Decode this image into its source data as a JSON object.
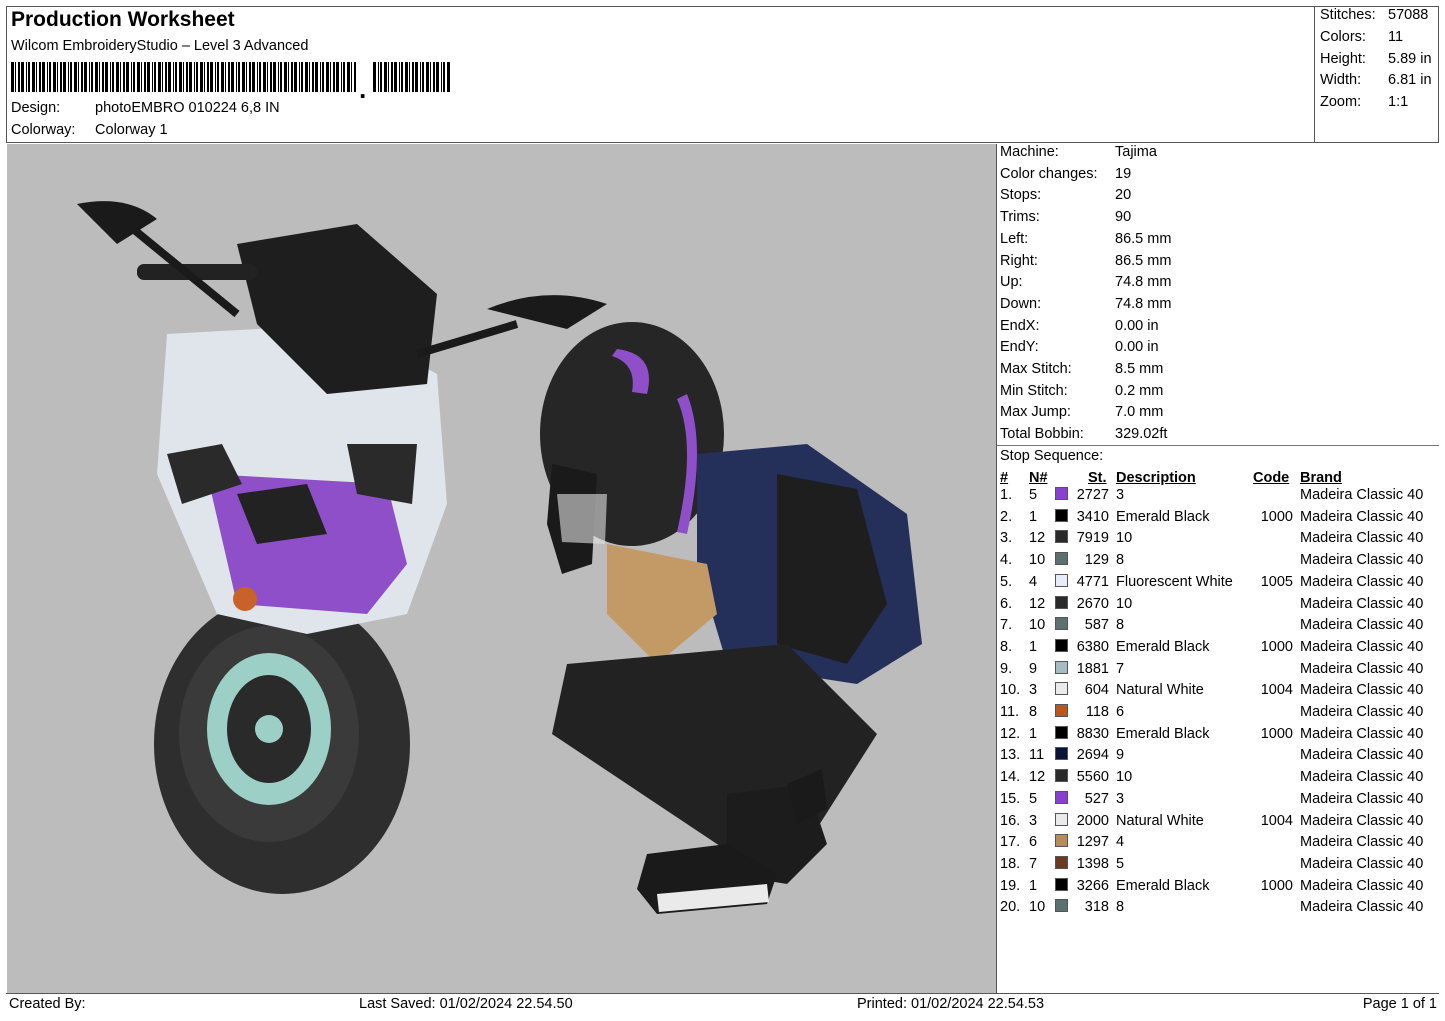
{
  "header": {
    "title": "Production Worksheet",
    "subtitle": "Wilcom EmbroideryStudio – Level 3 Advanced",
    "design_label": "Design:",
    "design_value": "photoEMBRO 010224 6,8 IN",
    "colorway_label": "Colorway:",
    "colorway_value": "Colorway 1"
  },
  "summary": [
    {
      "label": "Stitches:",
      "value": "57088"
    },
    {
      "label": "Colors:",
      "value": "11"
    },
    {
      "label": "Height:",
      "value": "5.89 in"
    },
    {
      "label": "Width:",
      "value": "6.81 in"
    },
    {
      "label": "Zoom:",
      "value": "1:1"
    }
  ],
  "info": [
    {
      "label": "Machine:",
      "value": "Tajima"
    },
    {
      "label": "Color changes:",
      "value": "19"
    },
    {
      "label": "Stops:",
      "value": "20"
    },
    {
      "label": "Trims:",
      "value": "90"
    },
    {
      "label": "Left:",
      "value": "86.5 mm"
    },
    {
      "label": "Right:",
      "value": "86.5 mm"
    },
    {
      "label": "Up:",
      "value": "74.8 mm"
    },
    {
      "label": "Down:",
      "value": "74.8 mm"
    },
    {
      "label": "EndX:",
      "value": "0.00 in"
    },
    {
      "label": "EndY:",
      "value": "0.00 in"
    },
    {
      "label": "Max Stitch:",
      "value": "8.5 mm"
    },
    {
      "label": "Min Stitch:",
      "value": "0.2 mm"
    },
    {
      "label": "Max Jump:",
      "value": "7.0 mm"
    },
    {
      "label": "Total Bobbin:",
      "value": "329.02ft"
    }
  ],
  "stop_sequence": {
    "title": "Stop Sequence:",
    "headers": {
      "num": "#",
      "n": "N#",
      "st": "St.",
      "desc": "Description",
      "code": "Code",
      "brand": "Brand"
    },
    "rows": [
      {
        "num": "1.",
        "n": "5",
        "color": "#8a3fd0",
        "st": "2727",
        "desc": "3",
        "code": "",
        "brand": "Madeira Classic 40"
      },
      {
        "num": "2.",
        "n": "1",
        "color": "#000000",
        "st": "3410",
        "desc": "Emerald Black",
        "code": "1000",
        "brand": "Madeira Classic 40"
      },
      {
        "num": "3.",
        "n": "12",
        "color": "#2a2a2a",
        "st": "7919",
        "desc": "10",
        "code": "",
        "brand": "Madeira Classic 40"
      },
      {
        "num": "4.",
        "n": "10",
        "color": "#5d7070",
        "st": "129",
        "desc": "8",
        "code": "",
        "brand": "Madeira Classic 40"
      },
      {
        "num": "5.",
        "n": "4",
        "color": "#e8ecf8",
        "st": "4771",
        "desc": "Fluorescent White",
        "code": "1005",
        "brand": "Madeira Classic 40"
      },
      {
        "num": "6.",
        "n": "12",
        "color": "#2a2a2a",
        "st": "2670",
        "desc": "10",
        "code": "",
        "brand": "Madeira Classic 40"
      },
      {
        "num": "7.",
        "n": "10",
        "color": "#5d7070",
        "st": "587",
        "desc": "8",
        "code": "",
        "brand": "Madeira Classic 40"
      },
      {
        "num": "8.",
        "n": "1",
        "color": "#000000",
        "st": "6380",
        "desc": "Emerald Black",
        "code": "1000",
        "brand": "Madeira Classic 40"
      },
      {
        "num": "9.",
        "n": "9",
        "color": "#a5bcc2",
        "st": "1881",
        "desc": "7",
        "code": "",
        "brand": "Madeira Classic 40"
      },
      {
        "num": "10.",
        "n": "3",
        "color": "#eaeaea",
        "st": "604",
        "desc": "Natural White",
        "code": "1004",
        "brand": "Madeira Classic 40"
      },
      {
        "num": "11.",
        "n": "8",
        "color": "#b8581e",
        "st": "118",
        "desc": "6",
        "code": "",
        "brand": "Madeira Classic 40"
      },
      {
        "num": "12.",
        "n": "1",
        "color": "#000000",
        "st": "8830",
        "desc": "Emerald Black",
        "code": "1000",
        "brand": "Madeira Classic 40"
      },
      {
        "num": "13.",
        "n": "11",
        "color": "#0a1438",
        "st": "2694",
        "desc": "9",
        "code": "",
        "brand": "Madeira Classic 40"
      },
      {
        "num": "14.",
        "n": "12",
        "color": "#2a2a2a",
        "st": "5560",
        "desc": "10",
        "code": "",
        "brand": "Madeira Classic 40"
      },
      {
        "num": "15.",
        "n": "5",
        "color": "#8a3fd0",
        "st": "527",
        "desc": "3",
        "code": "",
        "brand": "Madeira Classic 40"
      },
      {
        "num": "16.",
        "n": "3",
        "color": "#eaeaea",
        "st": "2000",
        "desc": "Natural White",
        "code": "1004",
        "brand": "Madeira Classic 40"
      },
      {
        "num": "17.",
        "n": "6",
        "color": "#b88b5a",
        "st": "1297",
        "desc": "4",
        "code": "",
        "brand": "Madeira Classic 40"
      },
      {
        "num": "18.",
        "n": "7",
        "color": "#6b3a20",
        "st": "1398",
        "desc": "5",
        "code": "",
        "brand": "Madeira Classic 40"
      },
      {
        "num": "19.",
        "n": "1",
        "color": "#000000",
        "st": "3266",
        "desc": "Emerald Black",
        "code": "1000",
        "brand": "Madeira Classic 40"
      },
      {
        "num": "20.",
        "n": "10",
        "color": "#5d7070",
        "st": "318",
        "desc": "8",
        "code": "",
        "brand": "Madeira Classic 40"
      }
    ]
  },
  "footer": {
    "created_by": "Created By:",
    "last_saved": "Last Saved: 01/02/2024 22.54.50",
    "printed": "Printed: 01/02/2024 22.54.53",
    "page": "Page 1 of 1"
  }
}
